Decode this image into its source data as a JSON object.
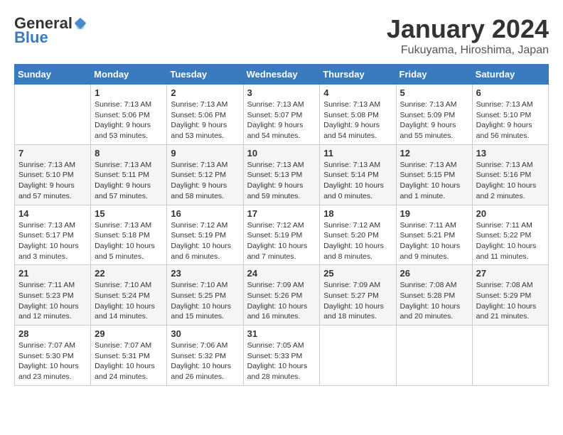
{
  "logo": {
    "general": "General",
    "blue": "Blue"
  },
  "header": {
    "month": "January 2024",
    "location": "Fukuyama, Hiroshima, Japan"
  },
  "weekdays": [
    "Sunday",
    "Monday",
    "Tuesday",
    "Wednesday",
    "Thursday",
    "Friday",
    "Saturday"
  ],
  "weeks": [
    [
      {
        "day": "",
        "info": ""
      },
      {
        "day": "1",
        "info": "Sunrise: 7:13 AM\nSunset: 5:06 PM\nDaylight: 9 hours\nand 53 minutes."
      },
      {
        "day": "2",
        "info": "Sunrise: 7:13 AM\nSunset: 5:06 PM\nDaylight: 9 hours\nand 53 minutes."
      },
      {
        "day": "3",
        "info": "Sunrise: 7:13 AM\nSunset: 5:07 PM\nDaylight: 9 hours\nand 54 minutes."
      },
      {
        "day": "4",
        "info": "Sunrise: 7:13 AM\nSunset: 5:08 PM\nDaylight: 9 hours\nand 54 minutes."
      },
      {
        "day": "5",
        "info": "Sunrise: 7:13 AM\nSunset: 5:09 PM\nDaylight: 9 hours\nand 55 minutes."
      },
      {
        "day": "6",
        "info": "Sunrise: 7:13 AM\nSunset: 5:10 PM\nDaylight: 9 hours\nand 56 minutes."
      }
    ],
    [
      {
        "day": "7",
        "info": "Sunrise: 7:13 AM\nSunset: 5:10 PM\nDaylight: 9 hours\nand 57 minutes."
      },
      {
        "day": "8",
        "info": "Sunrise: 7:13 AM\nSunset: 5:11 PM\nDaylight: 9 hours\nand 57 minutes."
      },
      {
        "day": "9",
        "info": "Sunrise: 7:13 AM\nSunset: 5:12 PM\nDaylight: 9 hours\nand 58 minutes."
      },
      {
        "day": "10",
        "info": "Sunrise: 7:13 AM\nSunset: 5:13 PM\nDaylight: 9 hours\nand 59 minutes."
      },
      {
        "day": "11",
        "info": "Sunrise: 7:13 AM\nSunset: 5:14 PM\nDaylight: 10 hours\nand 0 minutes."
      },
      {
        "day": "12",
        "info": "Sunrise: 7:13 AM\nSunset: 5:15 PM\nDaylight: 10 hours\nand 1 minute."
      },
      {
        "day": "13",
        "info": "Sunrise: 7:13 AM\nSunset: 5:16 PM\nDaylight: 10 hours\nand 2 minutes."
      }
    ],
    [
      {
        "day": "14",
        "info": "Sunrise: 7:13 AM\nSunset: 5:17 PM\nDaylight: 10 hours\nand 3 minutes."
      },
      {
        "day": "15",
        "info": "Sunrise: 7:13 AM\nSunset: 5:18 PM\nDaylight: 10 hours\nand 5 minutes."
      },
      {
        "day": "16",
        "info": "Sunrise: 7:12 AM\nSunset: 5:19 PM\nDaylight: 10 hours\nand 6 minutes."
      },
      {
        "day": "17",
        "info": "Sunrise: 7:12 AM\nSunset: 5:19 PM\nDaylight: 10 hours\nand 7 minutes."
      },
      {
        "day": "18",
        "info": "Sunrise: 7:12 AM\nSunset: 5:20 PM\nDaylight: 10 hours\nand 8 minutes."
      },
      {
        "day": "19",
        "info": "Sunrise: 7:11 AM\nSunset: 5:21 PM\nDaylight: 10 hours\nand 9 minutes."
      },
      {
        "day": "20",
        "info": "Sunrise: 7:11 AM\nSunset: 5:22 PM\nDaylight: 10 hours\nand 11 minutes."
      }
    ],
    [
      {
        "day": "21",
        "info": "Sunrise: 7:11 AM\nSunset: 5:23 PM\nDaylight: 10 hours\nand 12 minutes."
      },
      {
        "day": "22",
        "info": "Sunrise: 7:10 AM\nSunset: 5:24 PM\nDaylight: 10 hours\nand 14 minutes."
      },
      {
        "day": "23",
        "info": "Sunrise: 7:10 AM\nSunset: 5:25 PM\nDaylight: 10 hours\nand 15 minutes."
      },
      {
        "day": "24",
        "info": "Sunrise: 7:09 AM\nSunset: 5:26 PM\nDaylight: 10 hours\nand 16 minutes."
      },
      {
        "day": "25",
        "info": "Sunrise: 7:09 AM\nSunset: 5:27 PM\nDaylight: 10 hours\nand 18 minutes."
      },
      {
        "day": "26",
        "info": "Sunrise: 7:08 AM\nSunset: 5:28 PM\nDaylight: 10 hours\nand 20 minutes."
      },
      {
        "day": "27",
        "info": "Sunrise: 7:08 AM\nSunset: 5:29 PM\nDaylight: 10 hours\nand 21 minutes."
      }
    ],
    [
      {
        "day": "28",
        "info": "Sunrise: 7:07 AM\nSunset: 5:30 PM\nDaylight: 10 hours\nand 23 minutes."
      },
      {
        "day": "29",
        "info": "Sunrise: 7:07 AM\nSunset: 5:31 PM\nDaylight: 10 hours\nand 24 minutes."
      },
      {
        "day": "30",
        "info": "Sunrise: 7:06 AM\nSunset: 5:32 PM\nDaylight: 10 hours\nand 26 minutes."
      },
      {
        "day": "31",
        "info": "Sunrise: 7:05 AM\nSunset: 5:33 PM\nDaylight: 10 hours\nand 28 minutes."
      },
      {
        "day": "",
        "info": ""
      },
      {
        "day": "",
        "info": ""
      },
      {
        "day": "",
        "info": ""
      }
    ]
  ]
}
